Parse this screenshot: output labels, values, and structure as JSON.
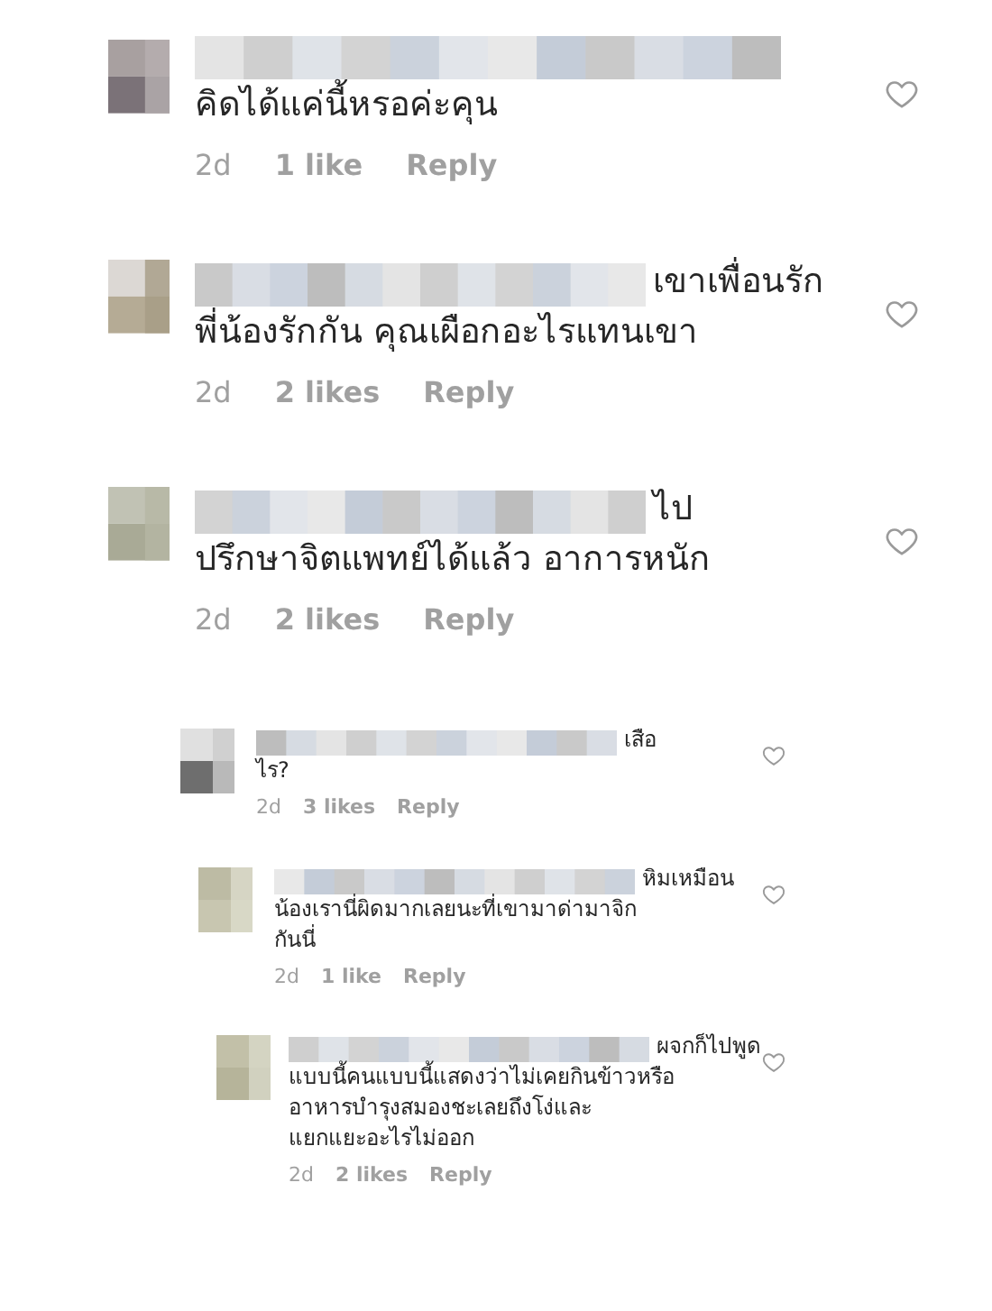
{
  "comments": [
    {
      "kind": "large",
      "lines": [
        "คิดได้แค่นี้หรอค่ะคุน"
      ],
      "time": "2d",
      "likes": "1 like",
      "reply": "Reply",
      "liked": false
    },
    {
      "kind": "large",
      "first_line": "เขาเพื่อนรัก",
      "lines": [
        "พี่น้องรักกัน คุณเผือกอะไรแทนเขา"
      ],
      "time": "2d",
      "likes": "2 likes",
      "reply": "Reply",
      "liked": false
    },
    {
      "kind": "large",
      "first_line": "ไป",
      "lines": [
        "ปรึกษาจิตแพทย์ได้แล้ว อาการหนัก"
      ],
      "time": "2d",
      "likes": "2 likes",
      "reply": "Reply",
      "liked": false
    },
    {
      "kind": "small",
      "first_line": "เสือ",
      "lines": [
        "ไร?"
      ],
      "time": "2d",
      "likes": "3 likes",
      "reply": "Reply",
      "liked": false
    },
    {
      "kind": "small",
      "first_line": "หิมเหมือน",
      "lines": [
        "น้องเรานี่ผิดมากเลยนะที่เขามาด่ามาจิก",
        "กันนี่"
      ],
      "time": "2d",
      "likes": "1 like",
      "reply": "Reply",
      "liked": false
    },
    {
      "kind": "small",
      "first_line": "ผจกก็ไปพูด",
      "lines": [
        "แบบนี้คนแบบนี้แสดงว่าไม่เคยกินข้าวหรือ",
        "อาหารบำรุงสมองชะเลยถึงโง่และ",
        "แยกแยะอะไรไม่ออก"
      ],
      "time": "2d",
      "likes": "2 likes",
      "reply": "Reply",
      "liked": false
    }
  ]
}
